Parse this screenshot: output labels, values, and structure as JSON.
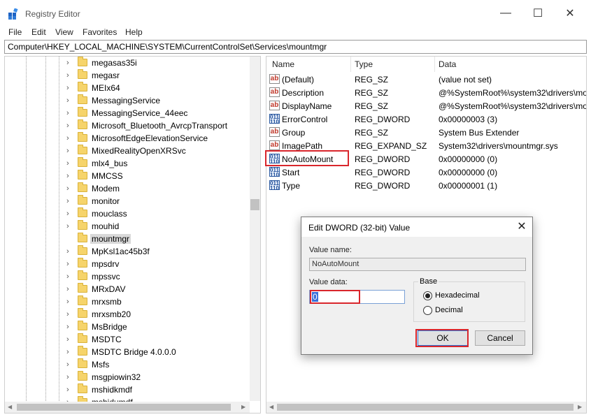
{
  "window": {
    "title": "Registry Editor",
    "minimize_glyph": "—",
    "maximize_glyph": "☐",
    "close_glyph": "✕",
    "icon": "registry-editor-icon"
  },
  "menu": [
    "File",
    "Edit",
    "View",
    "Favorites",
    "Help"
  ],
  "address": "Computer\\HKEY_LOCAL_MACHINE\\SYSTEM\\CurrentControlSet\\Services\\mountmgr",
  "tree": {
    "items": [
      "megasas35i",
      "megasr",
      "MEIx64",
      "MessagingService",
      "MessagingService_44eec",
      "Microsoft_Bluetooth_AvrcpTransport",
      "MicrosoftEdgeElevationService",
      "MixedRealityOpenXRSvc",
      "mlx4_bus",
      "MMCSS",
      "Modem",
      "monitor",
      "mouclass",
      "mouhid",
      "mountmgr",
      "MpKsl1ac45b3f",
      "mpsdrv",
      "mpssvc",
      "MRxDAV",
      "mrxsmb",
      "mrxsmb20",
      "MsBridge",
      "MSDTC",
      "MSDTC Bridge 4.0.0.0",
      "Msfs",
      "msgpiowin32",
      "mshidkmdf",
      "mshidumdf"
    ],
    "selected_index": 14,
    "no_expander_indices": [
      14
    ]
  },
  "list": {
    "columns": [
      "Name",
      "Type",
      "Data"
    ],
    "rows": [
      {
        "name": "(Default)",
        "type": "REG_SZ",
        "data": "(value not set)",
        "icon": "string-value-icon"
      },
      {
        "name": "Description",
        "type": "REG_SZ",
        "data": "@%SystemRoot%\\system32\\drivers\\mo",
        "icon": "string-value-icon"
      },
      {
        "name": "DisplayName",
        "type": "REG_SZ",
        "data": "@%SystemRoot%\\system32\\drivers\\mo",
        "icon": "string-value-icon"
      },
      {
        "name": "ErrorControl",
        "type": "REG_DWORD",
        "data": "0x00000003 (3)",
        "icon": "binary-value-icon"
      },
      {
        "name": "Group",
        "type": "REG_SZ",
        "data": "System Bus Extender",
        "icon": "string-value-icon"
      },
      {
        "name": "ImagePath",
        "type": "REG_EXPAND_SZ",
        "data": "System32\\drivers\\mountmgr.sys",
        "icon": "string-value-icon"
      },
      {
        "name": "NoAutoMount",
        "type": "REG_DWORD",
        "data": "0x00000000 (0)",
        "icon": "binary-value-icon"
      },
      {
        "name": "Start",
        "type": "REG_DWORD",
        "data": "0x00000000 (0)",
        "icon": "binary-value-icon"
      },
      {
        "name": "Type",
        "type": "REG_DWORD",
        "data": "0x00000001 (1)",
        "icon": "binary-value-icon"
      }
    ],
    "string_icon_text": "ab",
    "dword_icon_text": "011\n110"
  },
  "dialog": {
    "title": "Edit DWORD (32-bit) Value",
    "value_name_label": "Value name:",
    "value_name": "NoAutoMount",
    "value_data_label": "Value data:",
    "value_data": "0",
    "base_label": "Base",
    "base_options": [
      {
        "label": "Hexadecimal",
        "selected": true
      },
      {
        "label": "Decimal",
        "selected": false
      }
    ],
    "ok_label": "OK",
    "cancel_label": "Cancel",
    "close_glyph": "✕"
  },
  "colors": {
    "highlight_red": "#d9262c",
    "selection_blue": "#3a70d9",
    "folder_yellow": "#f6d46b"
  }
}
